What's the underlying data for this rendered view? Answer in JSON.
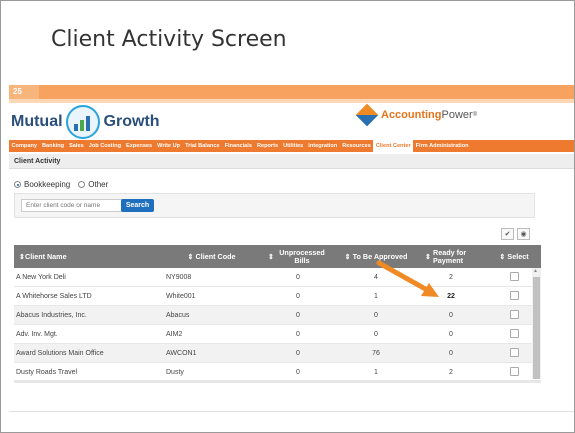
{
  "slide": {
    "title": "Client Activity Screen",
    "number": "25"
  },
  "brand": {
    "mutual_word": "Mutual",
    "growth_word": "Growth",
    "ap_accounting": "Accounting",
    "ap_power": "Power",
    "ap_reg": "®"
  },
  "nav": {
    "items": [
      "Company",
      "Banking",
      "Sales",
      "Job Costing",
      "Expenses",
      "Write Up",
      "Trial Balance",
      "Financials",
      "Reports",
      "Utilities",
      "Integration",
      "Resources",
      "Client Center",
      "Firm Administration"
    ],
    "active": "Client Center"
  },
  "page": {
    "section_title": "Client Activity"
  },
  "filter": {
    "options": [
      "Bookkeeping",
      "Other"
    ],
    "selected": "Bookkeeping",
    "placeholder": "Enter client code or name",
    "search_label": "Search"
  },
  "toolbar": {
    "check_symbol": "✔",
    "toggle_symbol": "◉"
  },
  "table": {
    "headers": {
      "name": "Client Name",
      "code": "Client Code",
      "unprocessed": "Unprocessed Bills",
      "approve": "To Be Approved",
      "ready": "Ready for Payment",
      "select": "Select"
    },
    "rows": [
      {
        "name": "A New York Deli",
        "code": "NY9008",
        "unprocessed": "0",
        "approve": "4",
        "ready": "2"
      },
      {
        "name": "A Whitehorse Sales LTD",
        "code": "White001",
        "unprocessed": "0",
        "approve": "1",
        "ready": "22"
      },
      {
        "name": "Abacus Industries, Inc.",
        "code": "Abacus",
        "unprocessed": "0",
        "approve": "0",
        "ready": "0"
      },
      {
        "name": "Adv. Inv. Mgt.",
        "code": "AIM2",
        "unprocessed": "0",
        "approve": "0",
        "ready": "0"
      },
      {
        "name": "Award Solutions Main Office",
        "code": "AWCON1",
        "unprocessed": "0",
        "approve": "76",
        "ready": "0"
      },
      {
        "name": "Dusty Roads Travel",
        "code": "Dusty",
        "unprocessed": "0",
        "approve": "1",
        "ready": "2"
      }
    ],
    "highlighted_row": 1
  },
  "colors": {
    "nav_orange": "#ee7a2f",
    "header_gray": "#7a7a7a",
    "search_blue": "#1f6fbf",
    "arrow_orange": "#f08a24"
  }
}
